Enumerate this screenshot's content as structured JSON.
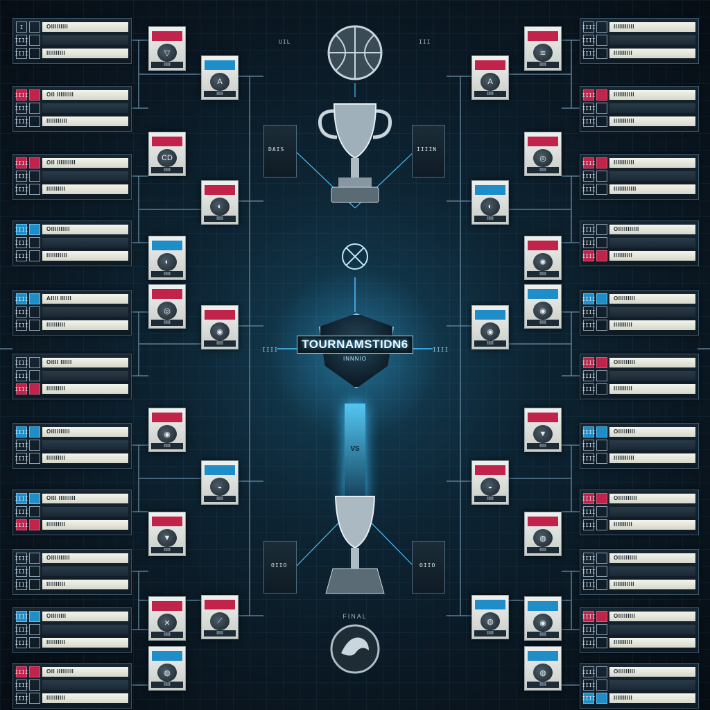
{
  "title": "TOURNAMSTIDN6",
  "subtitle": "INNNIO",
  "round_tags": {
    "top_left": "UIL",
    "top_right": "III",
    "mid_vs": "VS",
    "center_left": "IIII",
    "center_right": "IIII",
    "box_left_upper": "DAIS",
    "box_right_upper": "IIIIN",
    "box_left_lower": "OIIO",
    "box_right_lower": "OIIO",
    "final": "FINAL"
  },
  "left_matches": [
    {
      "rows": [
        {
          "seed": "I",
          "team": "OIIIIIIIII",
          "style": "dark"
        },
        {
          "seed": "IIII",
          "team": "",
          "style": ""
        },
        {
          "seed": "IIII",
          "team": "IIIIIIIIII",
          "style": ""
        }
      ]
    },
    {
      "rows": [
        {
          "seed": "IIII",
          "team": "OII IIIIIIIII",
          "style": "red"
        },
        {
          "seed": "IIII",
          "team": "",
          "style": ""
        },
        {
          "seed": "IIII",
          "team": "IIIIIIIIIII",
          "style": ""
        }
      ]
    },
    {
      "rows": [
        {
          "seed": "IIII",
          "team": "OII IIIIIIIIII",
          "style": "red"
        },
        {
          "seed": "IIII",
          "team": "",
          "style": ""
        },
        {
          "seed": "IIII",
          "team": "IIIIIIIIII",
          "style": ""
        }
      ]
    },
    {
      "rows": [
        {
          "seed": "IIII",
          "team": "OIIIIIIIIII",
          "style": "blue"
        },
        {
          "seed": "IIII",
          "team": "",
          "style": ""
        },
        {
          "seed": "IIII",
          "team": "IIIIIIIIIII",
          "style": ""
        }
      ]
    },
    {
      "rows": [
        {
          "seed": "IIII",
          "team": "AIIII IIIIII",
          "style": "blue"
        },
        {
          "seed": "IIII",
          "team": "",
          "style": ""
        },
        {
          "seed": "IIII",
          "team": "IIIIIIIIII",
          "style": ""
        }
      ]
    },
    {
      "rows": [
        {
          "seed": "IIII",
          "team": "OIIII IIIIII",
          "style": ""
        },
        {
          "seed": "IIII",
          "team": "",
          "style": ""
        },
        {
          "seed": "IIII",
          "team": "IIIIIIIIII",
          "style": "red"
        }
      ]
    },
    {
      "rows": [
        {
          "seed": "IIII",
          "team": "OIIIIIIIIII",
          "style": "blue"
        },
        {
          "seed": "IIII",
          "team": "",
          "style": ""
        },
        {
          "seed": "IIII",
          "team": "IIIIIIIIII",
          "style": ""
        }
      ]
    },
    {
      "rows": [
        {
          "seed": "IIII",
          "team": "OIII IIIIIIIII",
          "style": "blue"
        },
        {
          "seed": "IIII",
          "team": "",
          "style": ""
        },
        {
          "seed": "IIII",
          "team": "IIIIIIIIII",
          "style": "red"
        }
      ]
    },
    {
      "rows": [
        {
          "seed": "IIII",
          "team": "OIIIIIIIIII",
          "style": ""
        },
        {
          "seed": "IIII",
          "team": "",
          "style": ""
        },
        {
          "seed": "IIII",
          "team": "IIIIIIIIII",
          "style": ""
        }
      ]
    },
    {
      "rows": [
        {
          "seed": "IIII",
          "team": "OIIIIIIII",
          "style": "blue"
        },
        {
          "seed": "IIII",
          "team": "",
          "style": ""
        },
        {
          "seed": "IIII",
          "team": "IIIIIIIIII",
          "style": ""
        }
      ]
    },
    {
      "rows": [
        {
          "seed": "IIII",
          "team": "OII IIIIIIIII",
          "style": "red"
        },
        {
          "seed": "IIII",
          "team": "",
          "style": ""
        },
        {
          "seed": "IIII",
          "team": "IIIIIIIIII",
          "style": ""
        }
      ]
    }
  ],
  "right_matches": [
    {
      "rows": [
        {
          "seed": "IIII",
          "team": "IIIIIIIIIII",
          "style": ""
        },
        {
          "seed": "IIII",
          "team": "",
          "style": ""
        },
        {
          "seed": "IIII",
          "team": "IIIIIIIIII",
          "style": ""
        }
      ]
    },
    {
      "rows": [
        {
          "seed": "IIII",
          "team": "IIIIIIIIIII",
          "style": "red"
        },
        {
          "seed": "IIII",
          "team": "",
          "style": ""
        },
        {
          "seed": "IIII",
          "team": "IIIIIIIIIII",
          "style": ""
        }
      ]
    },
    {
      "rows": [
        {
          "seed": "IIII",
          "team": "IIIIIIIIIII",
          "style": "red"
        },
        {
          "seed": "IIII",
          "team": "",
          "style": ""
        },
        {
          "seed": "IIII",
          "team": "IIIIIIIIIIII",
          "style": ""
        }
      ]
    },
    {
      "rows": [
        {
          "seed": "IIII",
          "team": "OIIIIIIIIIII",
          "style": ""
        },
        {
          "seed": "IIII",
          "team": "",
          "style": ""
        },
        {
          "seed": "IIII",
          "team": "IIIIIIIIII",
          "style": "red"
        }
      ]
    },
    {
      "rows": [
        {
          "seed": "IIII",
          "team": "OIIIIIIIII",
          "style": "blue"
        },
        {
          "seed": "IIII",
          "team": "",
          "style": ""
        },
        {
          "seed": "IIII",
          "team": "IIIIIIIIII",
          "style": ""
        }
      ]
    },
    {
      "rows": [
        {
          "seed": "IIII",
          "team": "OIIIIIIIII",
          "style": "red"
        },
        {
          "seed": "IIII",
          "team": "",
          "style": ""
        },
        {
          "seed": "IIII",
          "team": "IIIIIIIIII",
          "style": ""
        }
      ]
    },
    {
      "rows": [
        {
          "seed": "IIII",
          "team": "OIIIIIIIII",
          "style": "blue"
        },
        {
          "seed": "IIII",
          "team": "",
          "style": ""
        },
        {
          "seed": "IIII",
          "team": "IIIIIIIIIII",
          "style": ""
        }
      ]
    },
    {
      "rows": [
        {
          "seed": "IIII",
          "team": "OIIIIIIIIII",
          "style": "red"
        },
        {
          "seed": "IIII",
          "team": "",
          "style": ""
        },
        {
          "seed": "IIII",
          "team": "IIIIIIIIII",
          "style": ""
        }
      ]
    },
    {
      "rows": [
        {
          "seed": "IIII",
          "team": "OIIIIIIIIII",
          "style": ""
        },
        {
          "seed": "IIII",
          "team": "",
          "style": ""
        },
        {
          "seed": "IIII",
          "team": "IIIIIIIIIII",
          "style": ""
        }
      ]
    },
    {
      "rows": [
        {
          "seed": "IIII",
          "team": "OIIIIIIIII",
          "style": "red"
        },
        {
          "seed": "IIII",
          "team": "",
          "style": ""
        },
        {
          "seed": "IIII",
          "team": "IIIIIIIIII",
          "style": ""
        }
      ]
    },
    {
      "rows": [
        {
          "seed": "IIII",
          "team": "OIIIIIIIII",
          "style": ""
        },
        {
          "seed": "IIII",
          "team": "",
          "style": ""
        },
        {
          "seed": "IIII",
          "team": "IIIIIIIIII",
          "style": "blue"
        }
      ]
    }
  ],
  "left_badges": [
    {
      "label": "IIIII",
      "stripe": "red",
      "icon": "▽"
    },
    {
      "label": "IIIII",
      "stripe": "red",
      "icon": "CD"
    },
    {
      "label": "IIIII",
      "stripe": "blue",
      "icon": "◐"
    },
    {
      "label": "IIIII",
      "stripe": "red",
      "icon": "◎"
    },
    {
      "label": "IIIII",
      "stripe": "red",
      "icon": "◉"
    },
    {
      "label": "IIIII",
      "stripe": "red",
      "icon": "▼"
    },
    {
      "label": "IIIII",
      "stripe": "red",
      "icon": "✕"
    },
    {
      "label": "IIIII",
      "stripe": "blue",
      "icon": "◍"
    }
  ],
  "right_badges": [
    {
      "label": "IIIII",
      "stripe": "red",
      "icon": "≋"
    },
    {
      "label": "IIIII",
      "stripe": "red",
      "icon": "◎"
    },
    {
      "label": "IIIII",
      "stripe": "red",
      "icon": "✺"
    },
    {
      "label": "IIIII",
      "stripe": "blue",
      "icon": "◉"
    },
    {
      "label": "IIIII",
      "stripe": "red",
      "icon": "▼"
    },
    {
      "label": "IIIII",
      "stripe": "red",
      "icon": "◍"
    },
    {
      "label": "IIIII",
      "stripe": "blue",
      "icon": "◉"
    },
    {
      "label": "IIIII",
      "stripe": "blue",
      "icon": "◍"
    }
  ],
  "inner_left_badges": [
    {
      "label": "IIIII",
      "stripe": "blue",
      "icon": "A"
    },
    {
      "label": "IIIII",
      "stripe": "red",
      "icon": "◐"
    },
    {
      "label": "IIIII",
      "stripe": "red",
      "icon": "◉"
    },
    {
      "label": "IIIII",
      "stripe": "blue",
      "icon": "◒"
    },
    {
      "label": "IIIII",
      "stripe": "red",
      "icon": "⟋"
    }
  ],
  "inner_right_badges": [
    {
      "label": "IIIII",
      "stripe": "red",
      "icon": "A"
    },
    {
      "label": "IIIII",
      "stripe": "blue",
      "icon": "◐"
    },
    {
      "label": "IIIII",
      "stripe": "blue",
      "icon": "◉"
    },
    {
      "label": "IIIII",
      "stripe": "red",
      "icon": "◒"
    },
    {
      "label": "IIIII",
      "stripe": "blue",
      "icon": "◍"
    }
  ],
  "colors": {
    "red": "#c2234a",
    "blue": "#1f8ec8",
    "accent": "#49c3ff",
    "wire": "#5c7d92"
  }
}
